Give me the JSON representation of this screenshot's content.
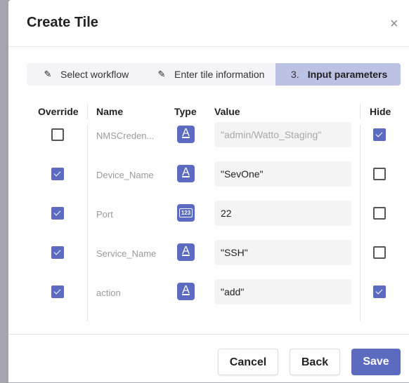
{
  "dialog": {
    "title": "Create Tile",
    "close_label": "×"
  },
  "steps": [
    {
      "icon": "pencil-icon",
      "label": "Select workflow"
    },
    {
      "icon": "pencil-icon",
      "label": "Enter tile information"
    },
    {
      "number": "3.",
      "label": "Input parameters"
    }
  ],
  "table": {
    "headers": {
      "override": "Override",
      "name": "Name",
      "type": "Type",
      "value": "Value",
      "hide": "Hide"
    },
    "rows": [
      {
        "override": false,
        "name": "NMSCreden...",
        "type": "string",
        "type_glyph": "A",
        "value": "\"admin/Watto_Staging\"",
        "value_disabled": true,
        "hide": true
      },
      {
        "override": true,
        "name": "Device_Name",
        "type": "string",
        "type_glyph": "A",
        "value": "\"SevOne\"",
        "value_disabled": false,
        "hide": false
      },
      {
        "override": true,
        "name": "Port",
        "type": "number",
        "type_glyph": "123",
        "value": "22",
        "value_disabled": false,
        "hide": false
      },
      {
        "override": true,
        "name": "Service_Name",
        "type": "string",
        "type_glyph": "A",
        "value": "\"SSH\"",
        "value_disabled": false,
        "hide": false
      },
      {
        "override": true,
        "name": "action",
        "type": "string",
        "type_glyph": "A",
        "value": "\"add\"",
        "value_disabled": false,
        "hide": true
      }
    ]
  },
  "footer": {
    "cancel_label": "Cancel",
    "back_label": "Back",
    "save_label": "Save"
  },
  "colors": {
    "accent": "#5c6bc0",
    "active_step_bg": "#bcc2e4"
  }
}
